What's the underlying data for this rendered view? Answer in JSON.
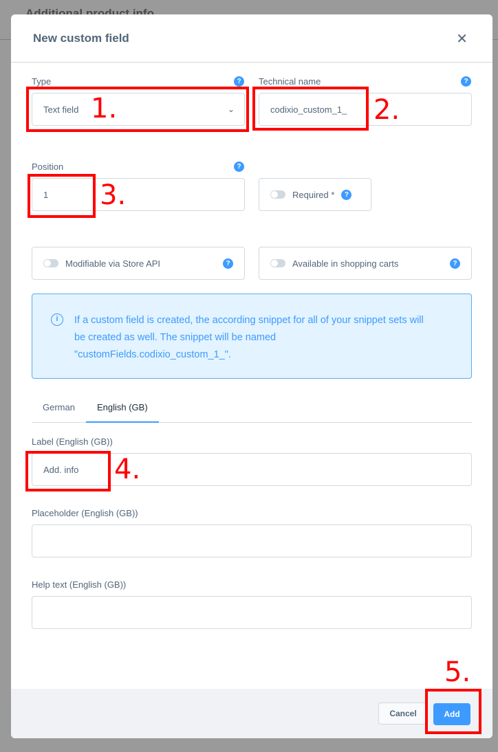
{
  "background": {
    "title": "Additional product info"
  },
  "modal": {
    "title": "New custom field",
    "type": {
      "label": "Type",
      "value": "Text field"
    },
    "technical_name": {
      "label": "Technical name",
      "value": "codixio_custom_1_"
    },
    "position": {
      "label": "Position",
      "value": "1"
    },
    "required": {
      "label": "Required *",
      "on": false
    },
    "store_api": {
      "label": "Modifiable via Store API",
      "on": false
    },
    "shopping_carts": {
      "label": "Available in shopping carts",
      "on": false
    },
    "info_text": "If a custom field is created, the according snippet for all of your snippet sets will be created as well. The snippet will be named \"customFields.codixio_custom_1_\".",
    "tabs": [
      {
        "label": "German",
        "active": false
      },
      {
        "label": "English (GB)",
        "active": true
      }
    ],
    "label_field": {
      "label": "Label (English (GB))",
      "value": "Add. info"
    },
    "placeholder_field": {
      "label": "Placeholder (English (GB))",
      "value": ""
    },
    "help_field": {
      "label": "Help text (English (GB))",
      "value": ""
    },
    "cancel": "Cancel",
    "add": "Add"
  },
  "annotations": [
    "1.",
    "2.",
    "3.",
    "4.",
    "5."
  ],
  "colors": {
    "accent": "#3d9bff",
    "annotation": "#ff0000"
  }
}
